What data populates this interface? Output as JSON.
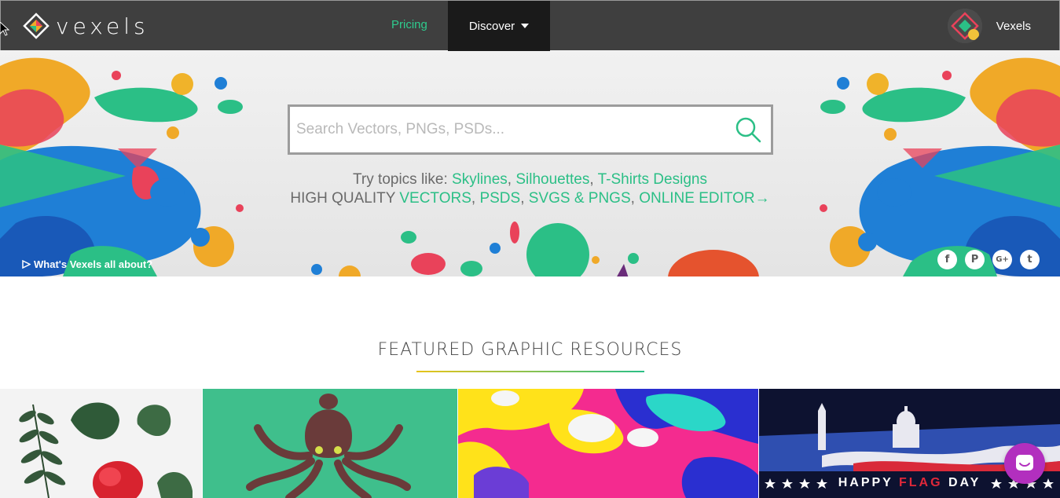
{
  "nav": {
    "brand": "vexels",
    "pricing": "Pricing",
    "discover": "Discover",
    "user_name": "Vexels"
  },
  "hero": {
    "search_placeholder": "Search Vectors, PNGs, PSDs...",
    "topics_prefix": "Try topics like: ",
    "topics": [
      "Skylines",
      "Silhouettes",
      "T-Shirts Designs"
    ],
    "quality_prefix": "HIGH QUALITY ",
    "quality_links": [
      "VECTORS",
      "PSDS",
      "SVGS & PNGS",
      "ONLINE EDITOR→"
    ],
    "about_link": "What's Vexels all about?",
    "socials": [
      {
        "name": "facebook-icon",
        "glyph": "f"
      },
      {
        "name": "pinterest-icon",
        "glyph": "P"
      },
      {
        "name": "google-plus-icon",
        "glyph": "G+"
      },
      {
        "name": "twitter-icon",
        "glyph": "t"
      }
    ]
  },
  "featured": {
    "title": "FEATURED GRAPHIC RESOURCES",
    "flag_day_text_1": "HAPPY ",
    "flag_day_text_2": "FLAG",
    "flag_day_text_3": " DAY"
  },
  "colors": {
    "nav_bg": "#3f3f3f",
    "discover_bg": "#1a1a1a",
    "accent_green": "#2bbf86",
    "chat_purple": "#b22fbe"
  }
}
